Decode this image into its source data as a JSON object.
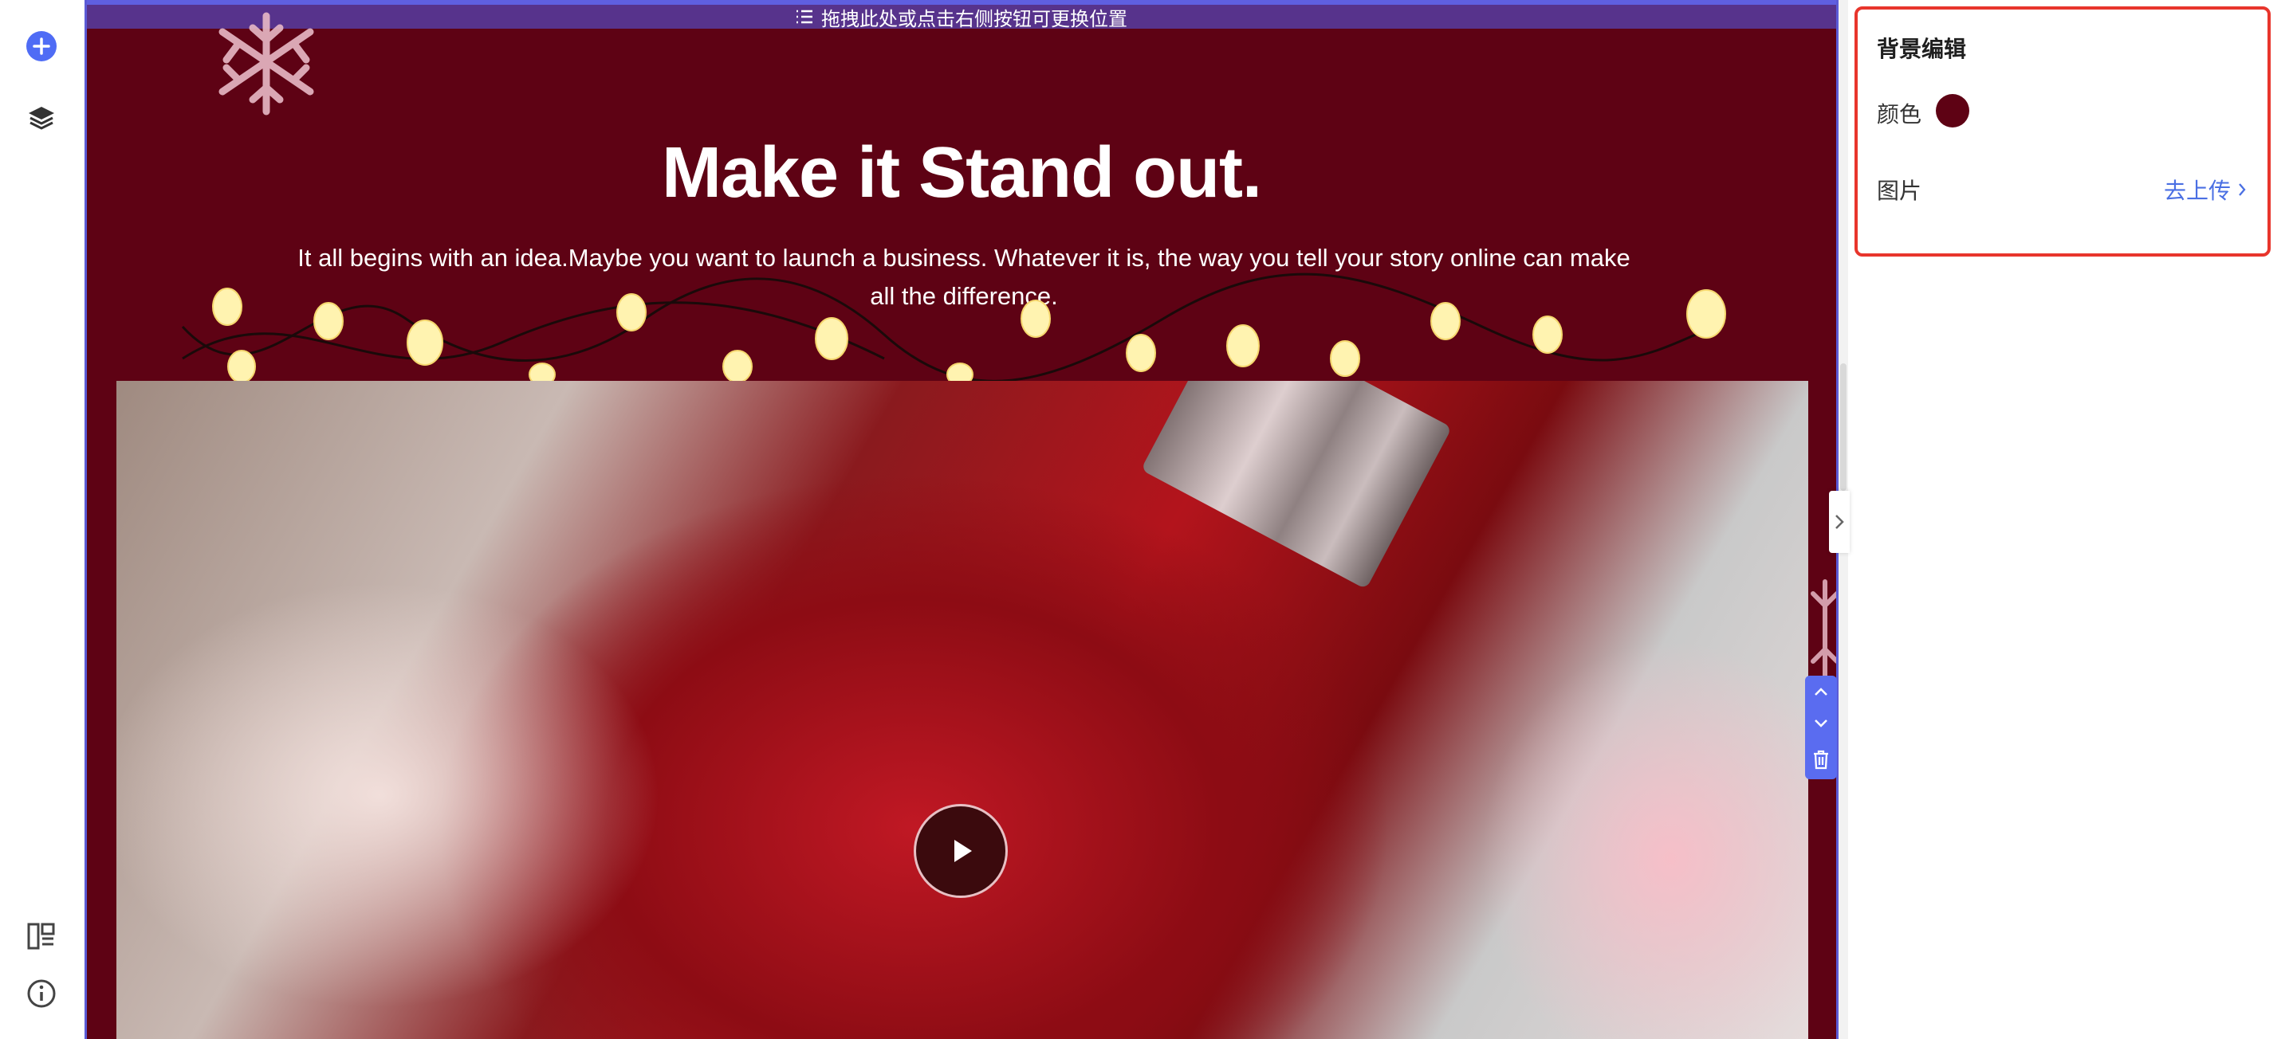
{
  "left_toolbar": {
    "add_icon": "plus-circle-icon",
    "layers_icon": "layers-icon",
    "layout_icon": "layout-icon",
    "info_icon": "info-icon"
  },
  "canvas": {
    "drag_hint": "拖拽此处或点击右侧按钮可更换位置",
    "headline": "Make it Stand out.",
    "subtext": "It all begins with an idea.Maybe you want to launch a business. Whatever it is, the way you tell your story online can make all the difference.",
    "background_color": "#5e0214"
  },
  "panel": {
    "title": "背景编辑",
    "color_label": "颜色",
    "color_value": "#5e0214",
    "image_label": "图片",
    "upload_label": "去上传"
  },
  "colors": {
    "accent": "#5a6cf0",
    "highlight_border": "#e8352c",
    "link": "#4a6fe3"
  }
}
